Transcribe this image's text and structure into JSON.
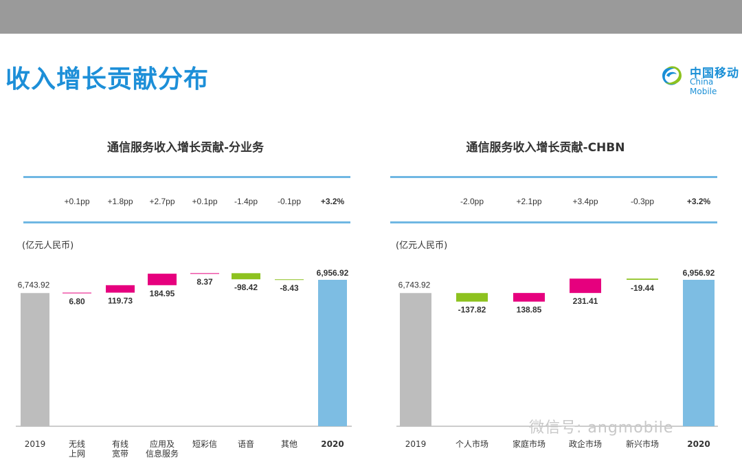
{
  "header": {
    "title": "收入增长贡献分布",
    "logo_cn": "中国移动",
    "logo_en": "China Mobile",
    "title_color": "#1d8fd8",
    "bar_color": "#9a9a9a"
  },
  "watermark": "微信号: angmobile",
  "colors": {
    "total_start": "#bdbdbd",
    "total_end": "#7dbde3",
    "positive": "#e6007e",
    "negative": "#8dc21f",
    "band": "#6fb7e3"
  },
  "chart_data": [
    {
      "type": "bar",
      "subtype": "waterfall",
      "title": "通信服务收入增长贡献-分业务",
      "unit_label": "(亿元人民币)",
      "categories": [
        [
          "2019"
        ],
        [
          "无线",
          "上网"
        ],
        [
          "有线",
          "宽带"
        ],
        [
          "应用及",
          "信息服务"
        ],
        [
          "短彩信"
        ],
        [
          "语音"
        ],
        [
          "其他"
        ],
        [
          "2020"
        ]
      ],
      "values": [
        6743.92,
        6.8,
        119.73,
        184.95,
        8.37,
        -98.42,
        -8.43,
        6956.92
      ],
      "labels": [
        "6,743.92",
        "6.80",
        "119.73",
        "184.95",
        "8.37",
        "-98.42",
        "-8.43",
        "6,956.92"
      ],
      "growth_pp": [
        "",
        "+0.1pp",
        "+1.8pp",
        "+2.7pp",
        "+0.1pp",
        "-1.4pp",
        "-0.1pp",
        "+3.2%"
      ],
      "bold_labels": [
        false,
        true,
        true,
        true,
        true,
        true,
        true,
        true
      ],
      "bold_categories": [
        false,
        false,
        false,
        false,
        false,
        false,
        false,
        true
      ],
      "bar_kinds": [
        "total_start",
        "positive",
        "positive",
        "positive",
        "positive",
        "negative",
        "negative",
        "total_end"
      ]
    },
    {
      "type": "bar",
      "subtype": "waterfall",
      "title": "通信服务收入增长贡献-CHBN",
      "unit_label": "(亿元人民币)",
      "categories": [
        [
          "2019"
        ],
        [
          "个人市场"
        ],
        [
          "家庭市场"
        ],
        [
          "政企市场"
        ],
        [
          "新兴市场"
        ],
        [
          "2020"
        ]
      ],
      "values": [
        6743.92,
        -137.82,
        138.85,
        231.41,
        -19.44,
        6956.92
      ],
      "labels": [
        "6,743.92",
        "-137.82",
        "138.85",
        "231.41",
        "-19.44",
        "6,956.92"
      ],
      "growth_pp": [
        "",
        "-2.0pp",
        "+2.1pp",
        "+3.4pp",
        "-0.3pp",
        "+3.2%"
      ],
      "bold_labels": [
        false,
        true,
        true,
        true,
        true,
        true
      ],
      "bold_categories": [
        false,
        false,
        false,
        false,
        false,
        true
      ],
      "bar_kinds": [
        "total_start",
        "negative",
        "positive",
        "positive",
        "negative",
        "total_end"
      ]
    }
  ]
}
